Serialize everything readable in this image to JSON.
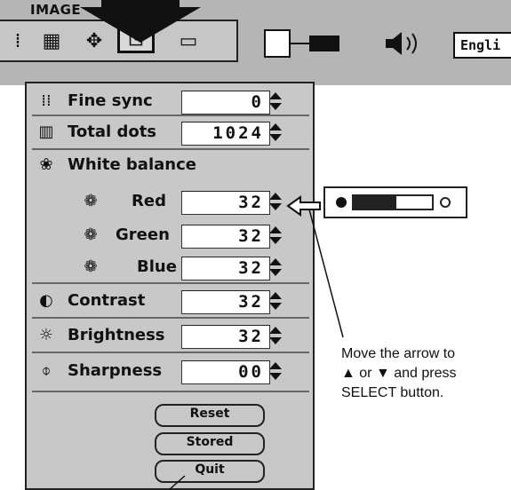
{
  "menu": {
    "title": "IMAGE",
    "icons": [
      "dots-icon",
      "pc-adjust-icon",
      "position-icon",
      "image-icon",
      "screen-icon",
      "projector-icon",
      "sound-icon"
    ],
    "language_label": "Engli"
  },
  "panel": {
    "rows": [
      {
        "icon": "fine-sync-icon",
        "label": "Fine sync",
        "value": "0"
      },
      {
        "icon": "total-dots-icon",
        "label": "Total dots",
        "value": "1024"
      },
      {
        "icon": "white-balance-icon",
        "label": "White balance"
      },
      {
        "icon": "red-icon",
        "label": "Red",
        "value": "32"
      },
      {
        "icon": "green-icon",
        "label": "Green",
        "value": "32"
      },
      {
        "icon": "blue-icon",
        "label": "Blue",
        "value": "32"
      },
      {
        "icon": "contrast-icon",
        "label": "Contrast",
        "value": "32"
      },
      {
        "icon": "brightness-icon",
        "label": "Brightness",
        "value": "32"
      },
      {
        "icon": "sharpness-icon",
        "label": "Sharpness",
        "value": "00"
      }
    ],
    "buttons": {
      "reset": "Reset",
      "stored": "Stored",
      "quit": "Quit"
    }
  },
  "slider": {
    "level": 0.55
  },
  "callout": {
    "line1": "Move the arrow to",
    "line2": "▲ or ▼  and press",
    "line3": "SELECT button."
  }
}
